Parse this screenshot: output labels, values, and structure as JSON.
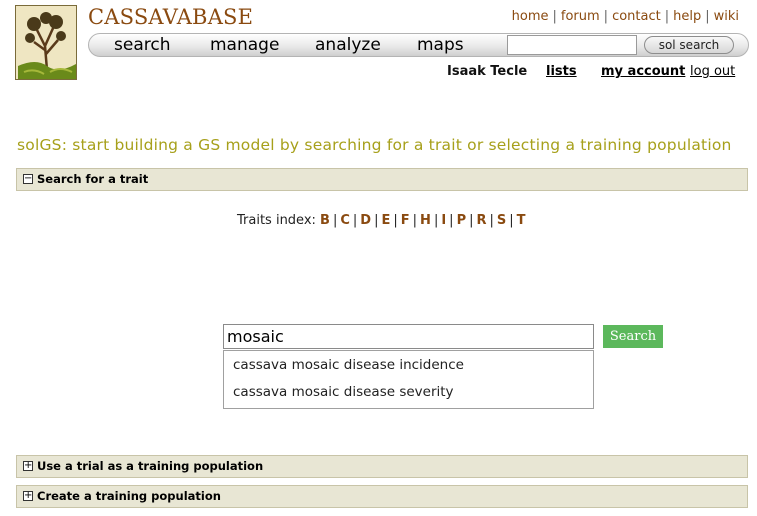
{
  "brand": {
    "name": "CASSAVABASE",
    "logo_icon": "cassava-tree-logo-icon"
  },
  "top_links": [
    "home",
    "forum",
    "contact",
    "help",
    "wiki"
  ],
  "nav": {
    "items": [
      "search",
      "manage",
      "analyze",
      "maps"
    ],
    "search_value": "",
    "search_button": "sol search"
  },
  "user": {
    "name": "Isaak Tecle",
    "lists": "lists",
    "account": "my account",
    "logout": "log out"
  },
  "page_title": "solGS: start building a GS model by searching for a trait or selecting a training population",
  "sections": {
    "search_trait": {
      "label": "Search for a trait",
      "toggle": "−"
    },
    "use_trial": {
      "label": "Use a trial as a training population",
      "toggle": "+"
    },
    "create_population": {
      "label": "Create a training population",
      "toggle": "+"
    }
  },
  "traits_index": {
    "label": "Traits index:",
    "letters": [
      "B",
      "C",
      "D",
      "E",
      "F",
      "H",
      "I",
      "P",
      "R",
      "S",
      "T"
    ]
  },
  "trait_search": {
    "value": "mosaic",
    "button": "Search",
    "suggestions": [
      "cassava mosaic disease incidence",
      "cassava mosaic disease severity"
    ]
  },
  "colors": {
    "brand": "#8a4a10",
    "title": "#a7a01b",
    "search_button": "#5cb85c",
    "section_bar": "#e8e6d4"
  }
}
